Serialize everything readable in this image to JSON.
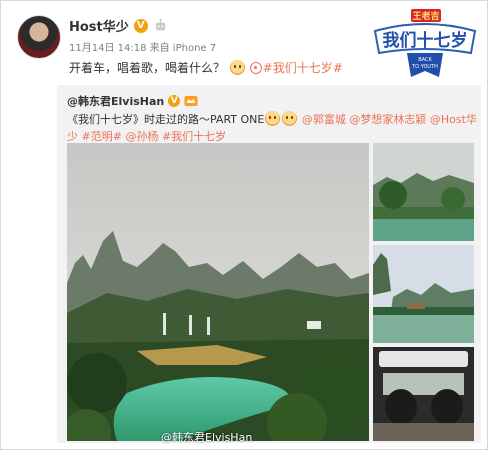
{
  "post": {
    "author": "Host华少",
    "verified_badge": "V",
    "meta": "11月14日 14:18 来自 iPhone 7",
    "text": "开着车，唱着歌，喝着什么？",
    "hashtag": "#我们十七岁#"
  },
  "logo": {
    "brand": "王老吉",
    "title": "我们十七岁",
    "tagline_line1": "BACK",
    "tagline_line2": "TO YOUTH"
  },
  "repost": {
    "author": "@韩东君ElvisHan",
    "verified_badge": "V",
    "text_main": "《我们十七岁》时走过的路～PART ONE",
    "mention1": "@郭富城",
    "mention2": "@梦想家林志颖",
    "mention3": "@Host华少",
    "hashtag": "#范明#",
    "mention4": "@孙杨",
    "hashtag2": "#我们十七岁"
  },
  "watermark": "@韩东君ElvisHan",
  "colors": {
    "link": "#eb7350",
    "verified": "#f0a30a",
    "repost_bg": "#f2f2f5"
  }
}
